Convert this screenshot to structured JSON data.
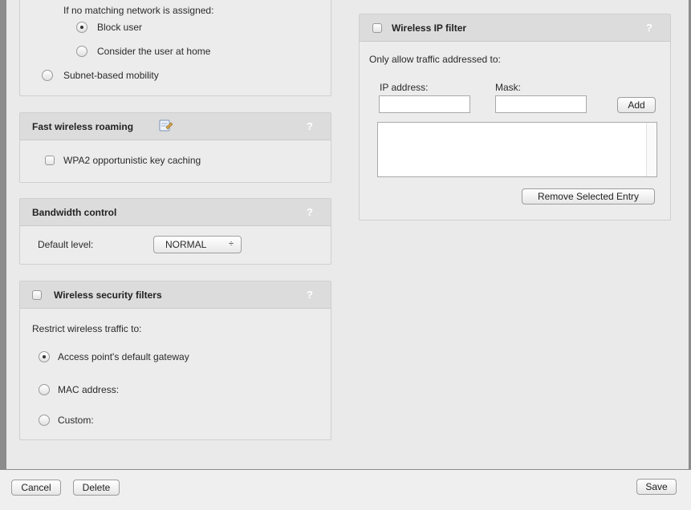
{
  "network_panel": {
    "no_match_text": "If no matching network is assigned:",
    "block_user": "Block user",
    "consider_home": "Consider the user at home",
    "subnet_mobility": "Subnet-based mobility"
  },
  "roaming_panel": {
    "title": "Fast wireless roaming",
    "help": "?",
    "wpa2_label": "WPA2 opportunistic key caching"
  },
  "bandwidth_panel": {
    "title": "Bandwidth control",
    "help": "?",
    "default_level_label": "Default level:",
    "level_value": "NORMAL",
    "arrows": "÷"
  },
  "security_panel": {
    "title": "Wireless security filters",
    "help": "?",
    "restrict_text": "Restrict wireless traffic to:",
    "opt_gateway": "Access point's default gateway",
    "opt_mac": "MAC address:",
    "opt_custom": "Custom:"
  },
  "ip_filter_panel": {
    "title": "Wireless IP filter",
    "help": "?",
    "only_allow_text": "Only allow traffic addressed to:",
    "ip_label": "IP address:",
    "mask_label": "Mask:",
    "ip_value": "",
    "mask_value": "",
    "add_button": "Add",
    "remove_button": "Remove Selected Entry"
  },
  "footer": {
    "cancel": "Cancel",
    "delete": "Delete",
    "save": "Save"
  }
}
